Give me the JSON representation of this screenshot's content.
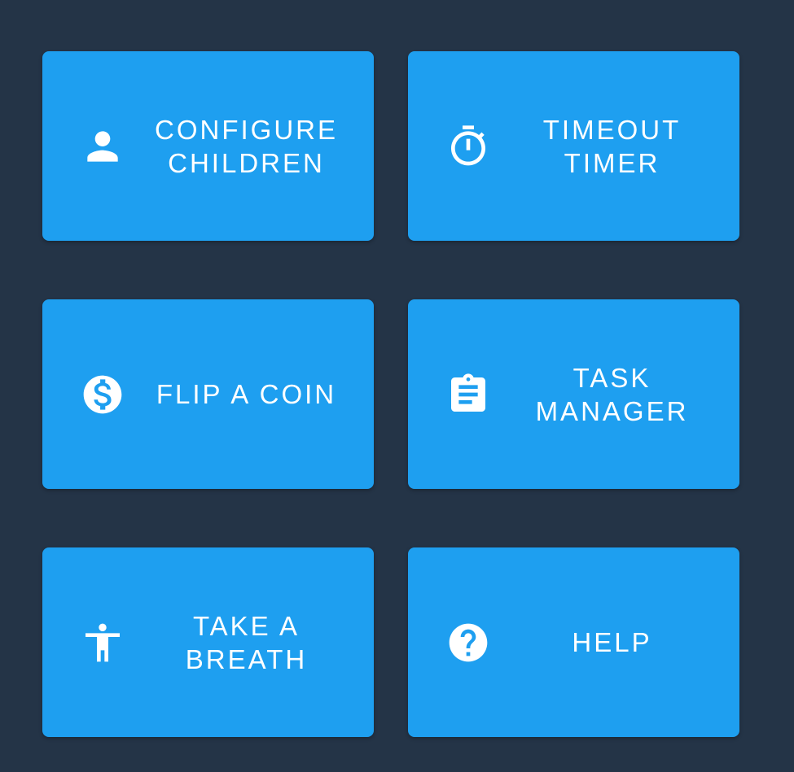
{
  "theme": {
    "background": "#243447",
    "tile": "#1e9ff0",
    "text": "#ffffff"
  },
  "tiles": [
    {
      "label": "CONFIGURE\nCHILDREN",
      "icon": "person-icon"
    },
    {
      "label": "TIMEOUT\nTIMER",
      "icon": "stopwatch-icon"
    },
    {
      "label": "FLIP A COIN",
      "icon": "dollar-coin-icon"
    },
    {
      "label": "TASK\nMANAGER",
      "icon": "clipboard-icon"
    },
    {
      "label": "TAKE A\nBREATH",
      "icon": "accessibility-person-icon"
    },
    {
      "label": "HELP",
      "icon": "help-circle-icon"
    }
  ]
}
